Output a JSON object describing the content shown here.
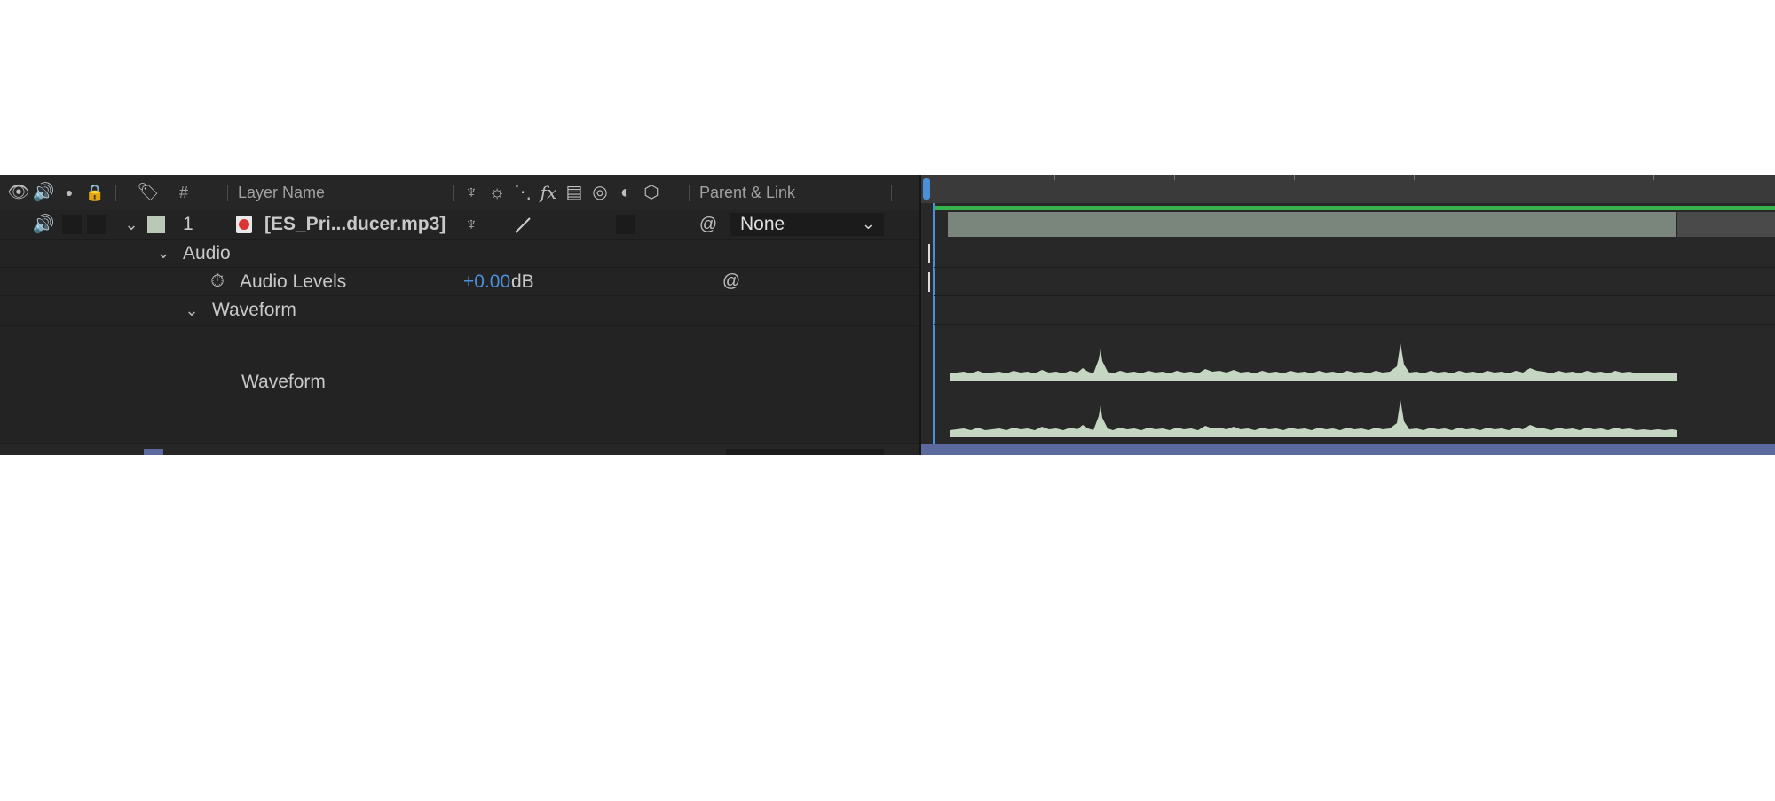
{
  "header": {
    "number_col": "#",
    "layer_name_col": "Layer Name",
    "parent_link_col": "Parent & Link"
  },
  "layer": {
    "index": "1",
    "name": "[ES_Pri...ducer.mp3]",
    "parent_value": "None",
    "label_color": "#b9c9b5"
  },
  "properties": {
    "audio_group": "Audio",
    "audio_levels_label": "Audio Levels",
    "audio_levels_value": "+0.00",
    "audio_levels_unit": "dB",
    "waveform_group": "Waveform",
    "waveform_label": "Waveform"
  },
  "colors": {
    "accent_blue": "#4a90d9",
    "work_area_green": "#36b34a",
    "layer_bar": "#7a857c",
    "waveform": "#c5d7c2",
    "next_layer_bar": "#5d6aa0"
  },
  "icons": [
    "eye-icon",
    "speaker-icon",
    "solo-icon",
    "lock-icon",
    "label-tag-icon",
    "shy-icon",
    "collapse-icon",
    "quality-icon",
    "fx-icon",
    "frame-blend-icon",
    "motion-blur-icon",
    "adjustment-icon",
    "3d-layer-icon",
    "audio-file-icon",
    "pick-whip-icon",
    "stopwatch-icon",
    "chevron-down-icon"
  ]
}
